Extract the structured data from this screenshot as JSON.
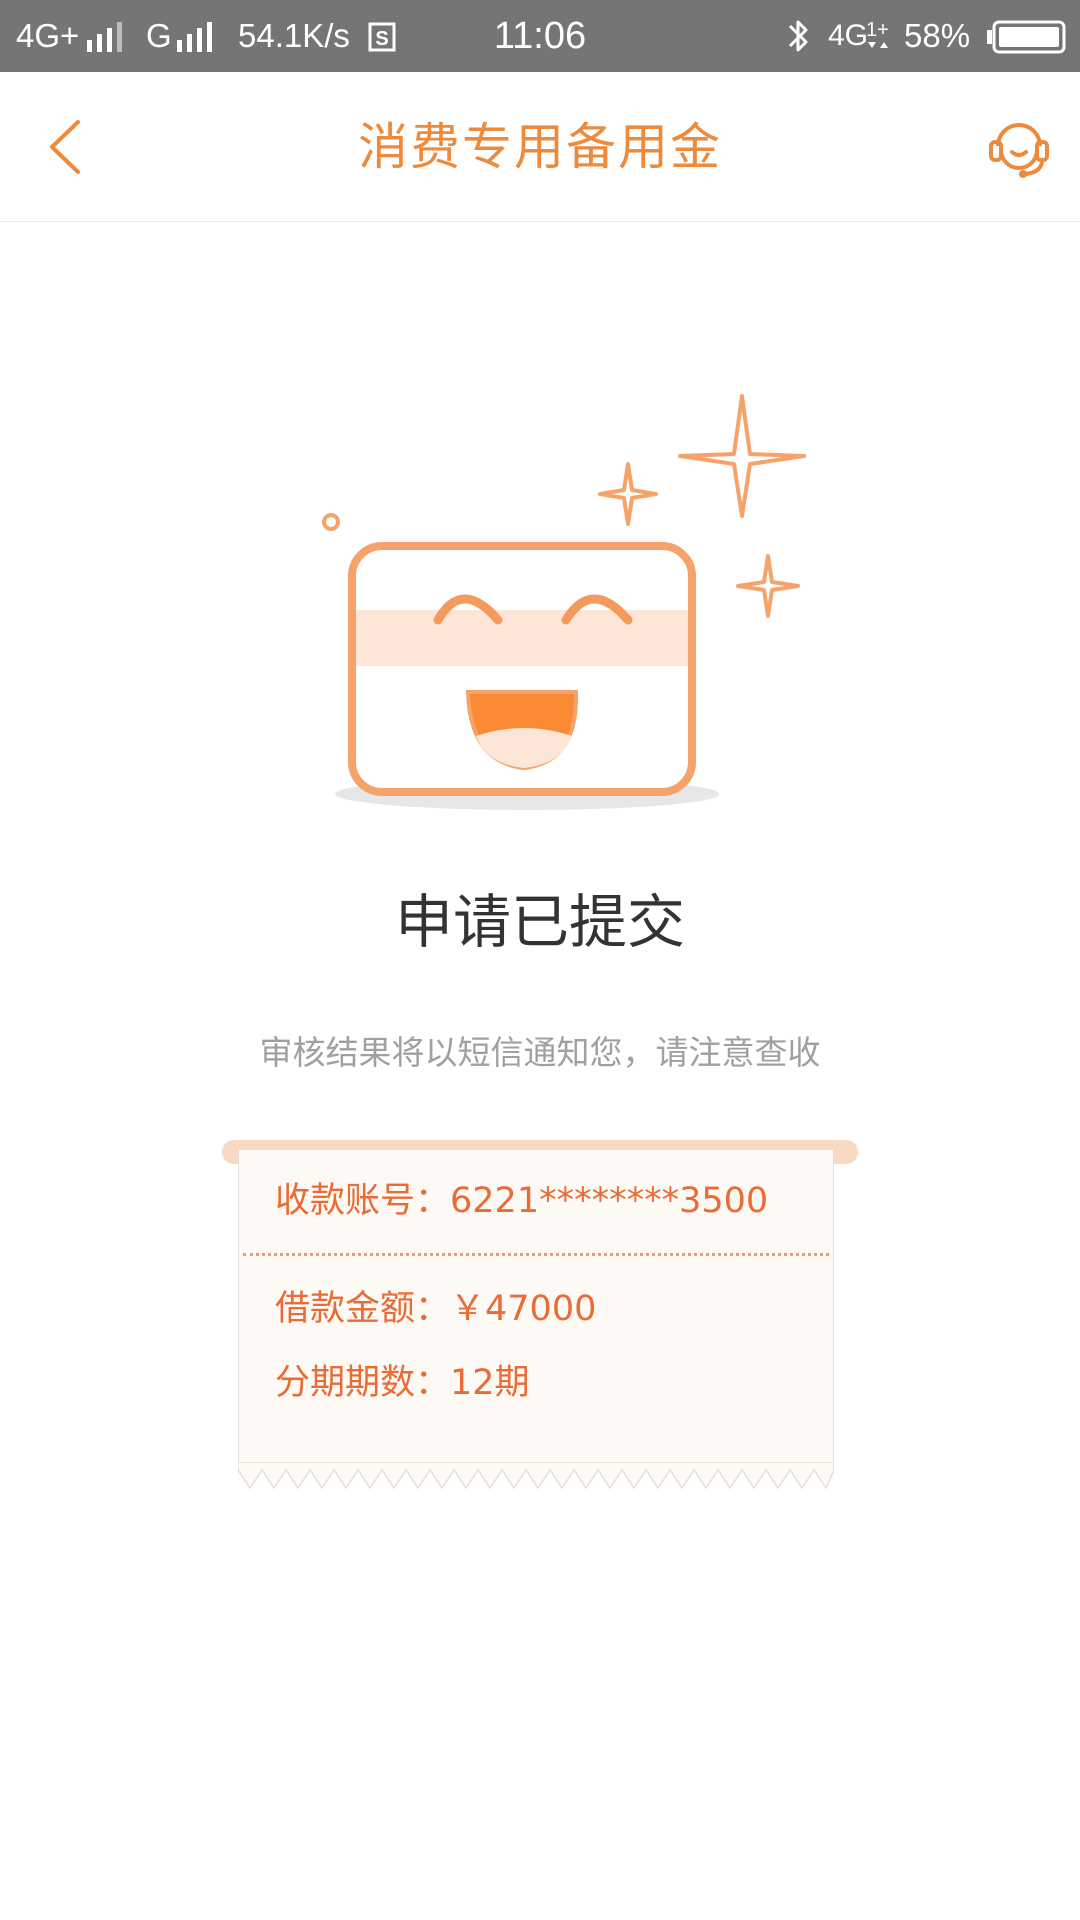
{
  "status_bar": {
    "network1": "4G+",
    "network2": "G",
    "speed": "54.1K/s",
    "time": "11:06",
    "network3": "4G",
    "battery": "58%"
  },
  "header": {
    "title": "消费专用备用金",
    "back_icon": "chevron-left-icon",
    "service_icon": "customer-service-headset-icon"
  },
  "result": {
    "title": "申请已提交",
    "subtitle": "审核结果将以短信通知您，请注意查收"
  },
  "receipt": {
    "account_label": "收款账号：",
    "account_value": "6221********3500",
    "amount_label": "借款金额：",
    "amount_value": "￥47000",
    "installments_label": "分期期数：",
    "installments_value": "12期"
  },
  "colors": {
    "accent": "#ee8a3c",
    "receipt_text": "#ea6b35",
    "status_bar": "#757575"
  }
}
